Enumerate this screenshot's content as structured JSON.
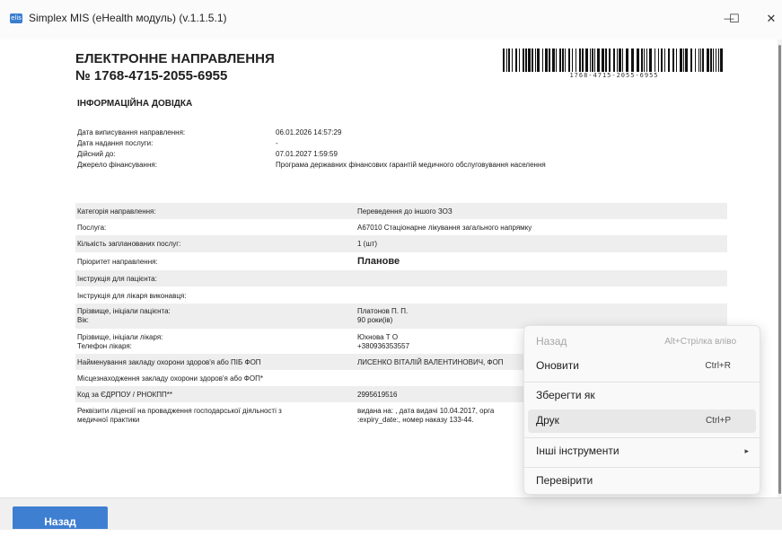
{
  "window": {
    "title": "Simplex MIS (eHealth модуль) (v.1.1.5.1)",
    "icon": "app-icon",
    "icon_glyph": "elis",
    "controls": {
      "minimize": "—",
      "maximize": "☐",
      "close": "✕"
    }
  },
  "doc": {
    "title_line1": "ЕЛЕКТРОННЕ НАПРАВЛЕННЯ",
    "title_line2": "№ 1768-4715-2055-6955",
    "barcode_text": "1768-4715-2055-6955",
    "section_title": "ІНФОРМАЦІЙНА ДОВІДКА",
    "info": [
      {
        "label": "Дата виписування направлення:",
        "value": "06.01.2026 14:57:29"
      },
      {
        "label": "Дата надання послуги:",
        "value": "-"
      },
      {
        "label": "Дійсний до:",
        "value": "07.01.2027 1:59:59"
      },
      {
        "label": "Джерело фінансування:",
        "value": "Програма державних фінансових гарантій медичного обслуговування населення"
      }
    ],
    "table": [
      {
        "label": "Категорія направлення:",
        "value": "Переведення до іншого ЗОЗ"
      },
      {
        "label": "Послуга:",
        "value": "А67010 Стаціонарне лікування загального напрямку"
      },
      {
        "label": "Кількість запланованих послуг:",
        "value": "1 (шт)"
      },
      {
        "label": "Пріоритет направлення:",
        "value": "Планове"
      },
      {
        "label": "Інструкція для пацієнта:",
        "value": ""
      },
      {
        "label": "Інструкція для лікаря виконавця:",
        "value": ""
      },
      {
        "label": "Прізвище, ініціали пацієнта:",
        "label2": "Вік:",
        "value": "Платонов П. П.",
        "value2": "90 роки(ів)"
      },
      {
        "label": "Прізвище, ініціали лікаря:",
        "label2": "Телефон лікаря:",
        "value": "Юхнова Т О",
        "value2": "+380936353557"
      },
      {
        "label": "Найменування закладу охорони здоров'я або ПІБ ФОП",
        "value": "ЛИСЕНКО ВІТАЛІЙ ВАЛЕНТИНОВИЧ, ФОП"
      },
      {
        "label": "Місцезнаходження закладу охорони здоров'я або ФОП*",
        "value": ""
      },
      {
        "label": "Код за ЄДРПОУ / РНОКПП**",
        "value": "2995619516"
      },
      {
        "label": "Реквізити ліцензії на провадження господарської діяльності з",
        "label2": "медичної практики",
        "value": "видана на: , дата видачі 10.04.2017, орга",
        "value2": ":expiry_date:, номер наказу 133-44."
      }
    ]
  },
  "buttons": {
    "back": "Назад"
  },
  "context_menu": {
    "items": [
      {
        "label": "Назад",
        "shortcut": "Alt+Стрілка вліво",
        "disabled": true
      },
      {
        "label": "Оновити",
        "shortcut": "Ctrl+R"
      },
      {
        "label": "Зберегти як",
        "shortcut": ""
      },
      {
        "label": "Друк",
        "shortcut": "Ctrl+P",
        "highlighted": true
      },
      {
        "label": "Інші інструменти",
        "shortcut": "",
        "submenu_arrow": "▸"
      },
      {
        "label": "Перевірити",
        "shortcut": ""
      }
    ]
  },
  "colors": {
    "accent": "#3e7fd1",
    "row_shade": "#eeeeee",
    "menu_bg": "#f9f9f9",
    "menu_highlight": "#e8e8e8"
  }
}
